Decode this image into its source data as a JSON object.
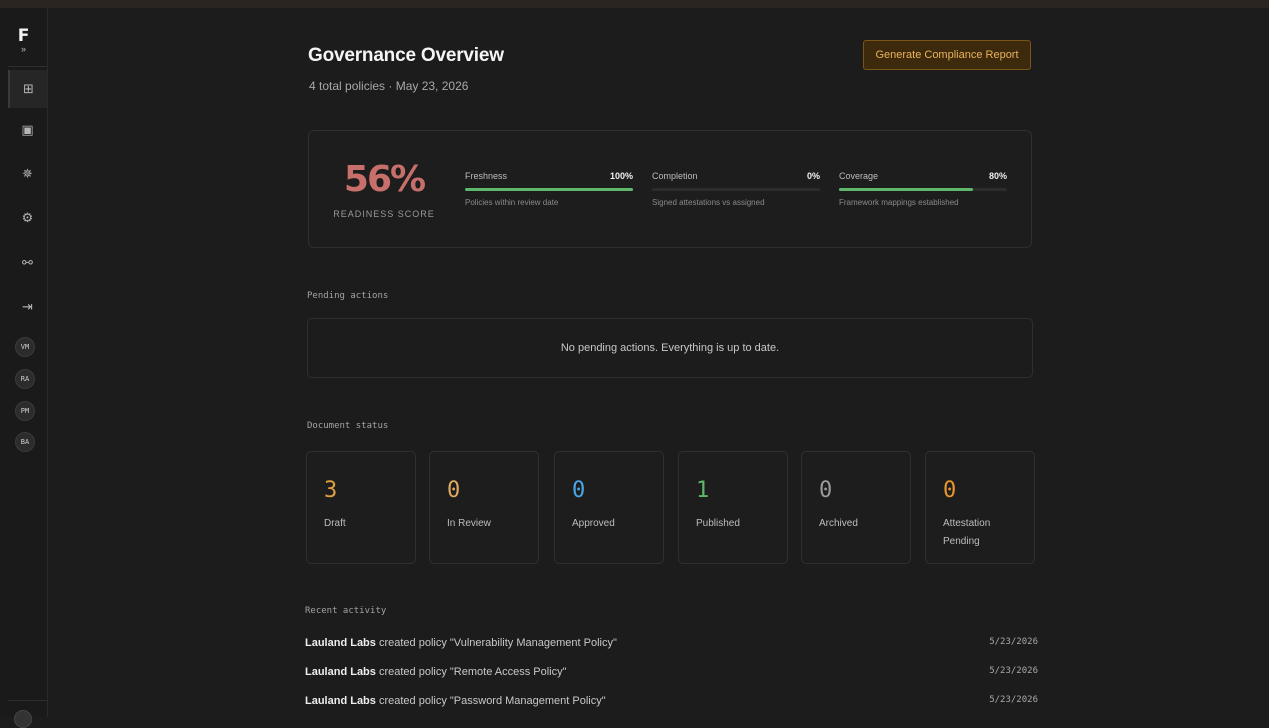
{
  "sidebar": {
    "logo": "F",
    "logo_sub": "»",
    "nav_icons": [
      {
        "name": "dashboard-icon",
        "glyph": "⊞"
      },
      {
        "name": "document-icon",
        "glyph": "▣"
      },
      {
        "name": "badge-icon",
        "glyph": "✵"
      },
      {
        "name": "gear-icon",
        "glyph": "⚙"
      },
      {
        "name": "link-icon",
        "glyph": "⚯"
      },
      {
        "name": "logout-icon",
        "glyph": "⇥"
      }
    ],
    "avatars": [
      "VM",
      "RA",
      "PM",
      "BA"
    ]
  },
  "header": {
    "title": "Governance Overview",
    "subtitle": "4 total policies · May 23, 2026",
    "generate_button": "Generate Compliance Report"
  },
  "readiness": {
    "score": "56%",
    "label": "READINESS SCORE",
    "metrics": [
      {
        "label": "Freshness",
        "value": "100%",
        "fraction": 1.0,
        "description": "Policies within review date"
      },
      {
        "label": "Completion",
        "value": "0%",
        "fraction": 0.0,
        "description": "Signed attestations vs assigned"
      },
      {
        "label": "Coverage",
        "value": "80%",
        "fraction": 0.8,
        "description": "Framework mappings established"
      }
    ]
  },
  "pending": {
    "heading": "Pending actions",
    "empty_message": "No pending actions. Everything is up to date."
  },
  "document_status": {
    "heading": "Document status",
    "items": [
      {
        "count": "3",
        "label": "Draft",
        "color": "#e0a040"
      },
      {
        "count": "0",
        "label": "In Review",
        "color": "#e0a860"
      },
      {
        "count": "0",
        "label": "Approved",
        "color": "#4aa8e8"
      },
      {
        "count": "1",
        "label": "Published",
        "color": "#5fb86a"
      },
      {
        "count": "0",
        "label": "Archived",
        "color": "#9a9a9a"
      },
      {
        "count": "0",
        "label": "Attestation Pending",
        "color": "#e8962e"
      }
    ]
  },
  "activity": {
    "heading": "Recent activity",
    "items": [
      {
        "actor": "Lauland Labs",
        "text": " created policy \"Vulnerability Management Policy\"",
        "date": "5/23/2026"
      },
      {
        "actor": "Lauland Labs",
        "text": " created policy \"Remote Access Policy\"",
        "date": "5/23/2026"
      },
      {
        "actor": "Lauland Labs",
        "text": " created policy \"Password Management Policy\"",
        "date": "5/23/2026"
      }
    ]
  },
  "colors": {
    "accent": "#e9b25a",
    "score": "#c76f6a",
    "progress": "#5fb86a"
  }
}
